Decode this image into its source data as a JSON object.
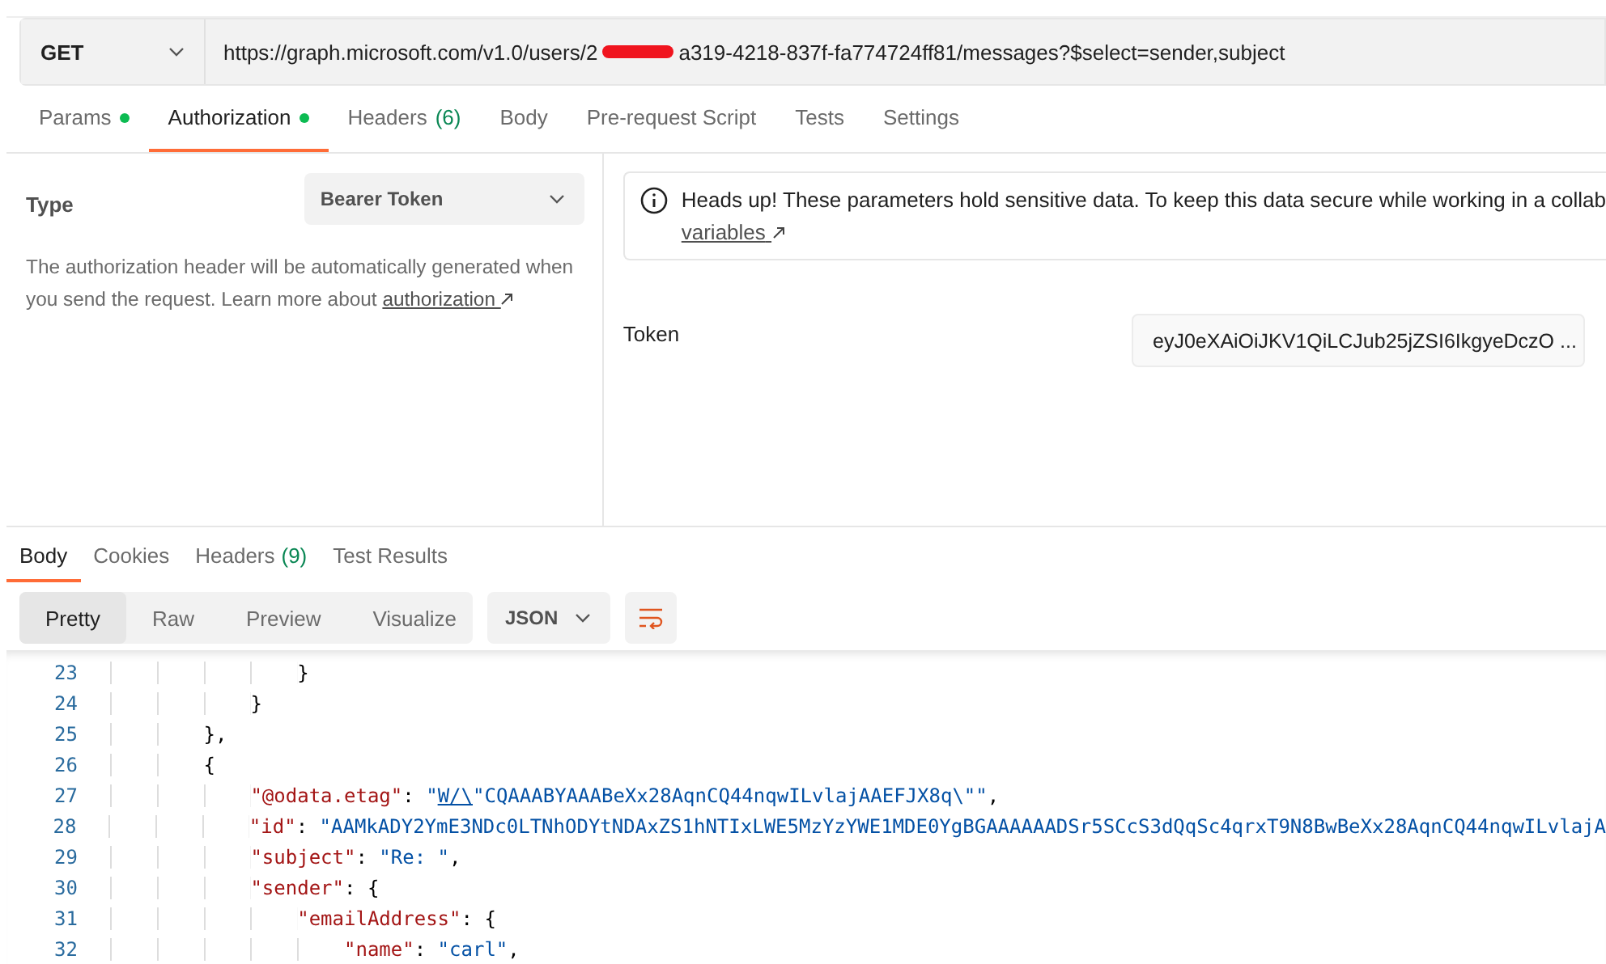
{
  "request": {
    "method": "GET",
    "url_before_redaction": "https://graph.microsoft.com/v1.0/users/2",
    "url_after_redaction": "a319-4218-837f-fa774724ff81/messages?$select=sender,subject"
  },
  "request_tabs": [
    {
      "label": "Params",
      "dot": true,
      "selected": false
    },
    {
      "label": "Authorization",
      "dot": true,
      "selected": true
    },
    {
      "label": "Headers",
      "count": "(6)",
      "dot": false,
      "selected": false
    },
    {
      "label": "Body",
      "dot": false,
      "selected": false
    },
    {
      "label": "Pre-request Script",
      "dot": false,
      "selected": false
    },
    {
      "label": "Tests",
      "dot": false,
      "selected": false
    },
    {
      "label": "Settings",
      "dot": false,
      "selected": false
    }
  ],
  "auth": {
    "type_label": "Type",
    "type_value": "Bearer Token",
    "description": "The authorization header will be automatically generated when you send the request. Learn more about",
    "description_link": "authorization",
    "notice": "Heads up! These parameters hold sensitive data. To keep this data secure while working in a collab",
    "notice_link": "variables",
    "token_label": "Token",
    "token_value": "eyJ0eXAiOiJKV1QiLCJub25jZSI6IkgyeDczO ..."
  },
  "response_tabs": [
    {
      "label": "Body",
      "selected": true
    },
    {
      "label": "Cookies",
      "selected": false
    },
    {
      "label": "Headers",
      "count": "(9)",
      "selected": false
    },
    {
      "label": "Test Results",
      "selected": false
    }
  ],
  "view_modes": [
    {
      "label": "Pretty",
      "selected": true
    },
    {
      "label": "Raw",
      "selected": false
    },
    {
      "label": "Preview",
      "selected": false
    },
    {
      "label": "Visualize",
      "selected": false
    }
  ],
  "format": "JSON",
  "code_lines": [
    {
      "number": "23",
      "tokens": [
        {
          "kind": "punct",
          "text": "                }"
        }
      ]
    },
    {
      "number": "24",
      "tokens": [
        {
          "kind": "punct",
          "text": "            }"
        }
      ]
    },
    {
      "number": "25",
      "tokens": [
        {
          "kind": "punct",
          "text": "        },"
        }
      ]
    },
    {
      "number": "26",
      "tokens": [
        {
          "kind": "punct",
          "text": "        {"
        }
      ]
    },
    {
      "number": "27",
      "tokens": [
        {
          "kind": "key",
          "text": "            \"@odata.etag\""
        },
        {
          "kind": "punct",
          "text": ": "
        },
        {
          "kind": "string",
          "text": "\""
        },
        {
          "kind": "link",
          "text": "W/\\"
        },
        {
          "kind": "string",
          "text": "\"CQAAABYAAABeXx28AqnCQ44nqwILvlajAAEFJX8q\\\"\""
        },
        {
          "kind": "punct",
          "text": ","
        }
      ]
    },
    {
      "number": "28",
      "tokens": [
        {
          "kind": "key",
          "text": "            \"id\""
        },
        {
          "kind": "punct",
          "text": ": "
        },
        {
          "kind": "string",
          "text": "\"AAMkADY2YmE3NDc0LTNhODYtNDAxZS1hNTIxLWE5MzYzYWE1MDE0YgBGAAAAAADSr5SCcS3dQqSc4qrxT9N8BwBeXx28AqnCQ44nqwILvlajA"
        }
      ]
    },
    {
      "number": "29",
      "tokens": [
        {
          "kind": "key",
          "text": "            \"subject\""
        },
        {
          "kind": "punct",
          "text": ": "
        },
        {
          "kind": "string",
          "text": "\"Re: \""
        },
        {
          "kind": "punct",
          "text": ","
        }
      ]
    },
    {
      "number": "30",
      "tokens": [
        {
          "kind": "key",
          "text": "            \"sender\""
        },
        {
          "kind": "punct",
          "text": ": {"
        }
      ]
    },
    {
      "number": "31",
      "tokens": [
        {
          "kind": "key",
          "text": "                \"emailAddress\""
        },
        {
          "kind": "punct",
          "text": ": {"
        }
      ]
    },
    {
      "number": "32",
      "tokens": [
        {
          "kind": "key",
          "text": "                    \"name\""
        },
        {
          "kind": "punct",
          "text": ": "
        },
        {
          "kind": "string",
          "text": "\"carl\""
        },
        {
          "kind": "punct",
          "text": ","
        }
      ]
    }
  ]
}
